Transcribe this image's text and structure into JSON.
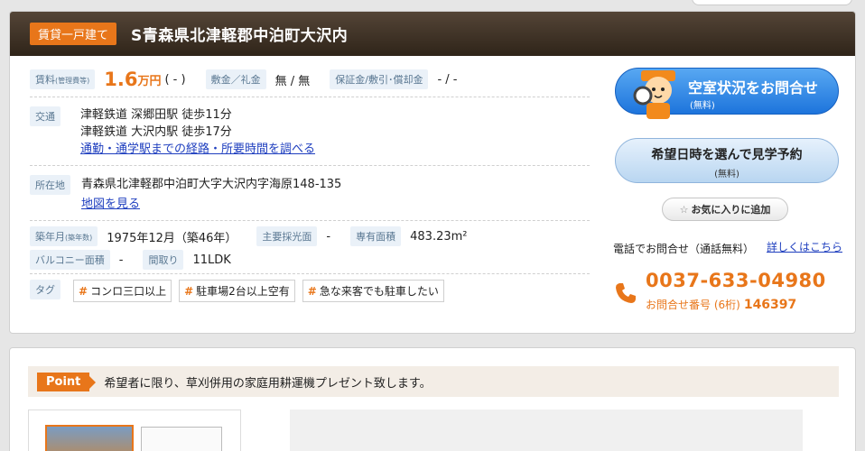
{
  "header": {
    "type_badge": "賃貸一戸建て",
    "title": "S青森県北津軽郡中泊町大沢内"
  },
  "details": {
    "rent_label": "賃料",
    "rent_label_sub": "(管理費等)",
    "rent_value": "1.6",
    "rent_unit": "万円",
    "rent_mgmt": "( - )",
    "deposit_label": "敷金／礼金",
    "deposit_value": "無 / 無",
    "guarantee_label": "保証金/敷引･償却金",
    "guarantee_value": "- / -",
    "transport_label": "交通",
    "transport_lines": [
      "津軽鉄道 深郷田駅 徒歩11分",
      "津軽鉄道 大沢内駅 徒歩17分"
    ],
    "route_link": "通勤・通学駅までの経路・所要時間を調べる",
    "address_label": "所在地",
    "address_value": "青森県北津軽郡中泊町大字大沢内字海原148-135",
    "map_link": "地図を見る",
    "built_label": "築年月",
    "built_label_sub": "(築年数)",
    "built_value": "1975年12月（築46年）",
    "lighting_label": "主要採光面",
    "lighting_value": "-",
    "area_label": "専有面積",
    "area_value": "483.23m²",
    "balcony_label": "バルコニー面積",
    "balcony_value": "-",
    "layout_label": "間取り",
    "layout_value": "11LDK",
    "tag_label": "タグ",
    "tags": [
      "コンロ三口以上",
      "駐車場2台以上空有",
      "急な来客でも駐車したい"
    ]
  },
  "sidebar": {
    "vacancy_btn_main": "空室状況をお問合せ",
    "vacancy_btn_sub": "(無料)",
    "visit_btn_main": "希望日時を選んで見学予約",
    "visit_btn_sub": "(無料)",
    "fav_btn": "お気に入りに追加",
    "phone_label": "電話でお問合せ（通話無料）",
    "phone_more": "詳しくはこちら",
    "phone_number": "0037-633-04980",
    "inquiry_label": "お問合せ番号 (6桁)",
    "inquiry_number": "146397"
  },
  "point": {
    "badge": "Point",
    "text": "希望者に限り、草刈併用の家庭用耕運機プレゼント致します。"
  },
  "colors": {
    "accent": "#e8761a",
    "header_dark": "#3b2f25",
    "link": "#1f3fbf"
  }
}
